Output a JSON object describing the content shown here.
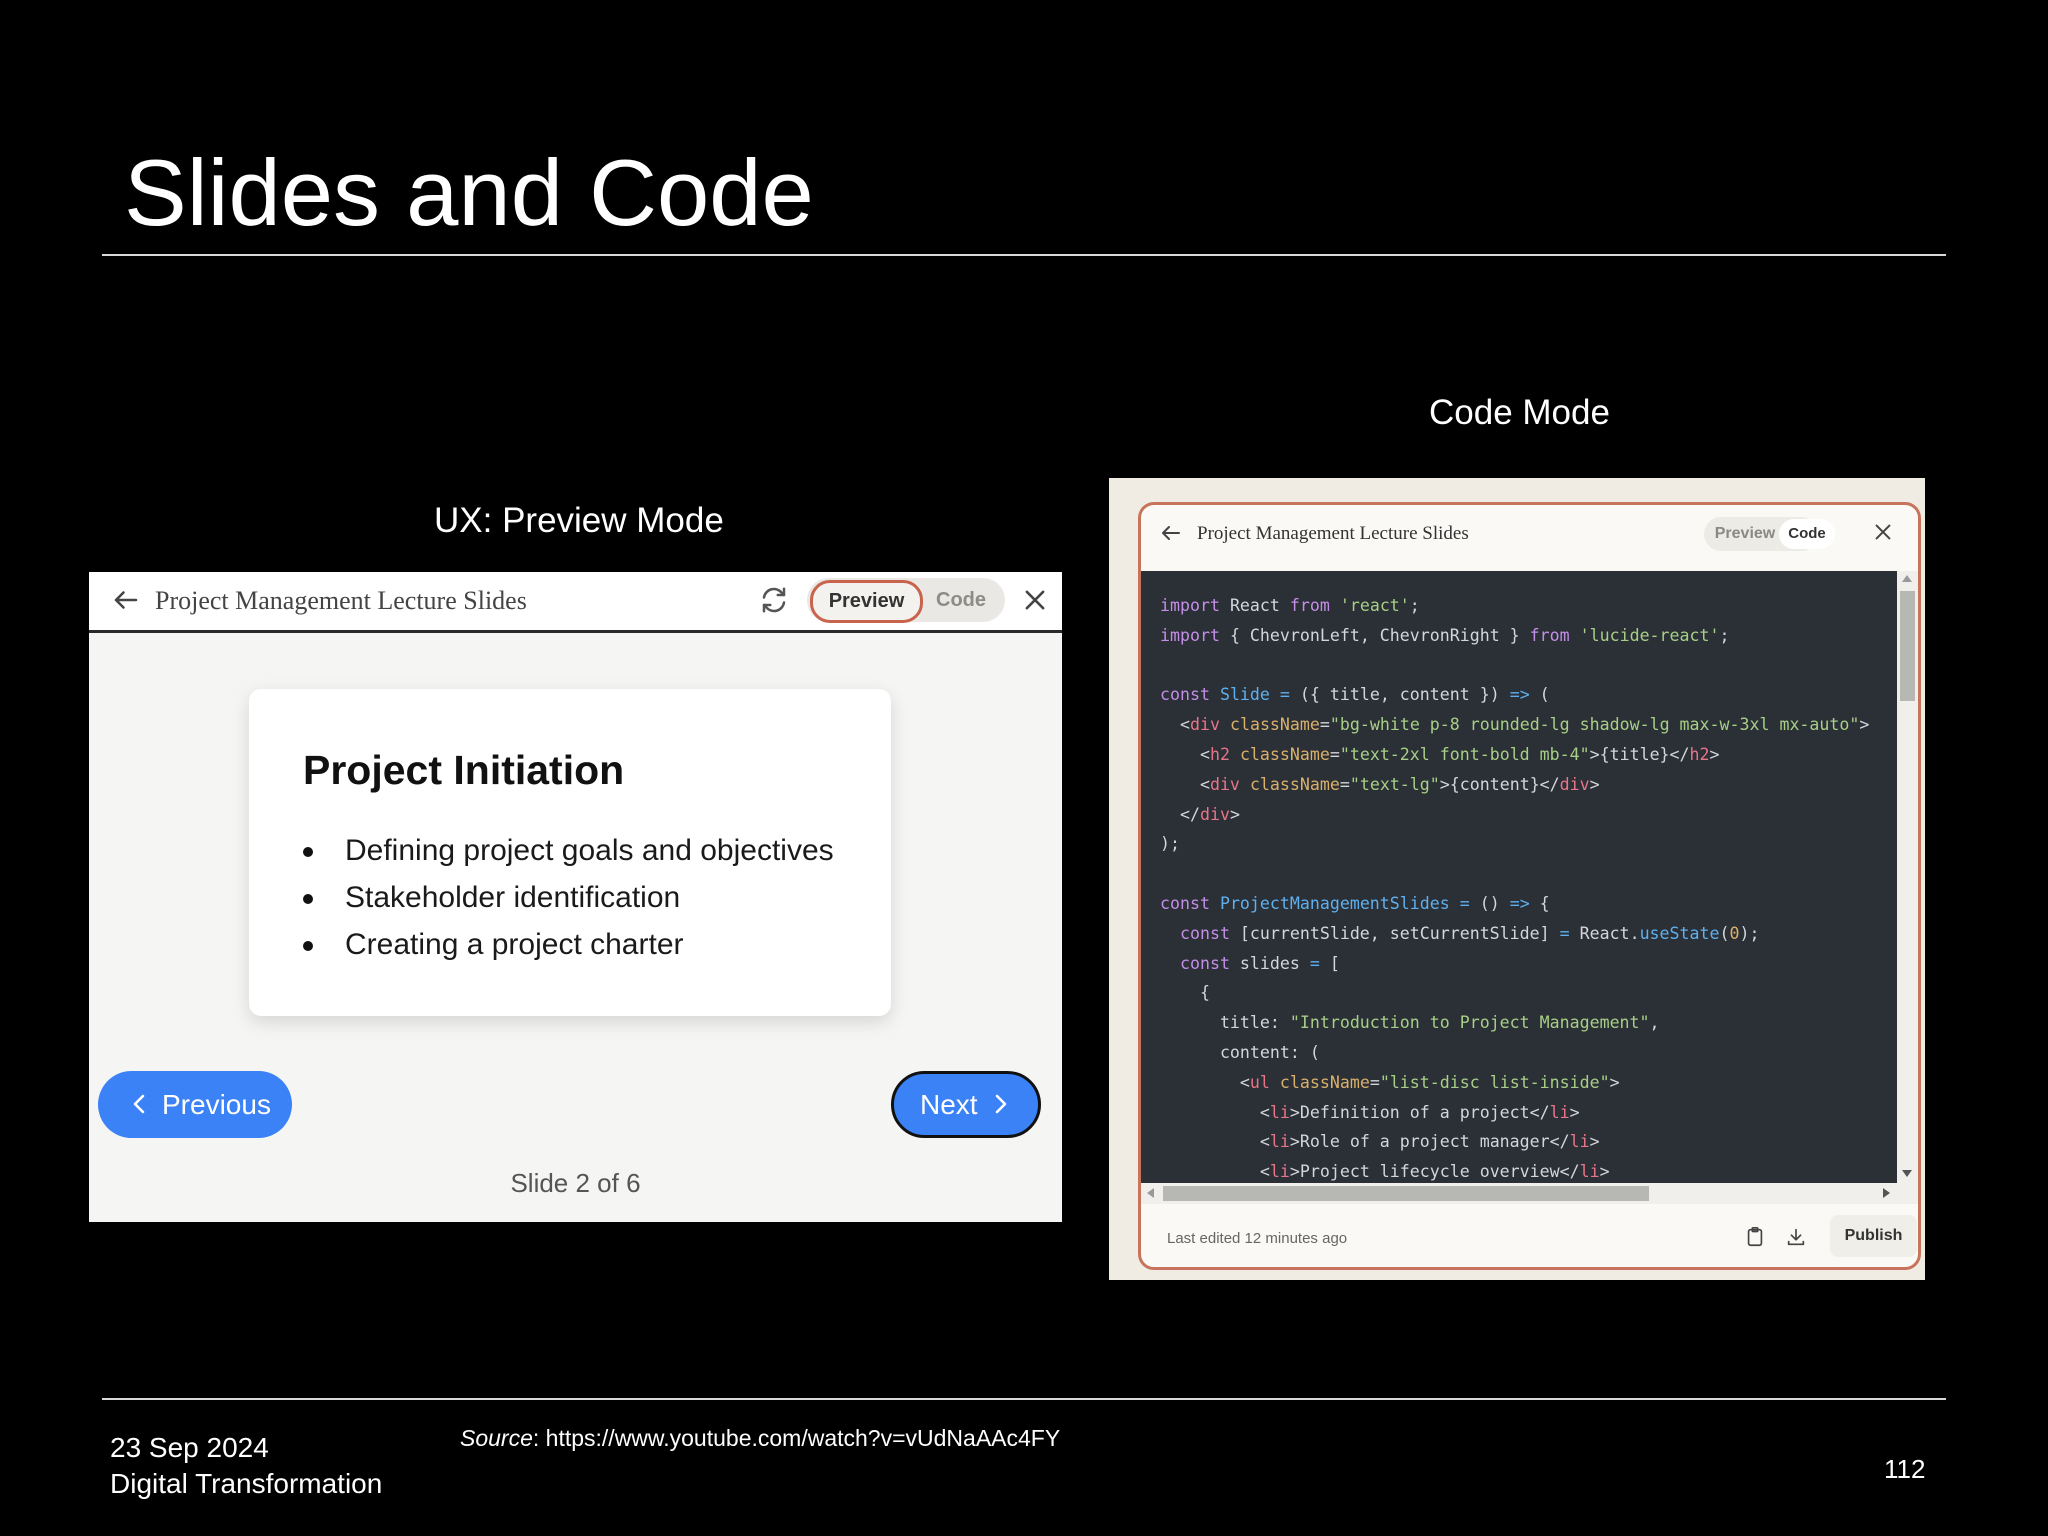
{
  "slide": {
    "title": "Slides and Code",
    "caption_preview": "UX: Preview Mode",
    "caption_code": "Code Mode",
    "footer_date": "23 Sep 2024",
    "footer_course": "Digital Transformation",
    "source_label": "Source",
    "source_url": ": https://www.youtube.com/watch?v=vUdNaAAc4FY",
    "page_number": "112"
  },
  "preview_panel": {
    "header_title": "Project Management Lecture Slides",
    "tab_preview": "Preview",
    "tab_code": "Code",
    "card_title": "Project Initiation",
    "bullets": [
      "Defining project goals and objectives",
      "Stakeholder identification",
      "Creating a project charter"
    ],
    "prev_label": "Previous",
    "next_label": "Next",
    "slide_counter": "Slide 2 of 6"
  },
  "code_panel": {
    "header_title": "Project Management Lecture Slides",
    "tab_preview": "Preview",
    "tab_code": "Code",
    "footer_text": "Last edited 12 minutes ago",
    "publish_label": "Publish",
    "code_lines": [
      [
        [
          "kw",
          "import"
        ],
        [
          "t",
          " React "
        ],
        [
          "kw",
          "from"
        ],
        [
          "t",
          " "
        ],
        [
          "str",
          "'react'"
        ],
        [
          "t",
          ";"
        ]
      ],
      [
        [
          "kw",
          "import"
        ],
        [
          "t",
          " { ChevronLeft, ChevronRight } "
        ],
        [
          "kw",
          "from"
        ],
        [
          "t",
          " "
        ],
        [
          "str",
          "'lucide-react'"
        ],
        [
          "t",
          ";"
        ]
      ],
      [],
      [
        [
          "kw",
          "const"
        ],
        [
          "t",
          " "
        ],
        [
          "fn",
          "Slide"
        ],
        [
          "t",
          " "
        ],
        [
          "op",
          "="
        ],
        [
          "t",
          " ({ title, content }) "
        ],
        [
          "op",
          "=>"
        ],
        [
          "t",
          " ("
        ]
      ],
      [
        [
          "t",
          "  <"
        ],
        [
          "tag",
          "div"
        ],
        [
          "t",
          " "
        ],
        [
          "attr",
          "className"
        ],
        [
          "t",
          "="
        ],
        [
          "str",
          "\"bg-white p-8 rounded-lg shadow-lg max-w-3xl mx-auto\""
        ],
        [
          "t",
          ">"
        ]
      ],
      [
        [
          "t",
          "    <"
        ],
        [
          "tag",
          "h2"
        ],
        [
          "t",
          " "
        ],
        [
          "attr",
          "className"
        ],
        [
          "t",
          "="
        ],
        [
          "str",
          "\"text-2xl font-bold mb-4\""
        ],
        [
          "t",
          ">{title}</"
        ],
        [
          "tag",
          "h2"
        ],
        [
          "t",
          ">"
        ]
      ],
      [
        [
          "t",
          "    <"
        ],
        [
          "tag",
          "div"
        ],
        [
          "t",
          " "
        ],
        [
          "attr",
          "className"
        ],
        [
          "t",
          "="
        ],
        [
          "str",
          "\"text-lg\""
        ],
        [
          "t",
          ">{content}</"
        ],
        [
          "tag",
          "div"
        ],
        [
          "t",
          ">"
        ]
      ],
      [
        [
          "t",
          "  </"
        ],
        [
          "tag",
          "div"
        ],
        [
          "t",
          ">"
        ]
      ],
      [
        [
          "t",
          ");"
        ]
      ],
      [],
      [
        [
          "kw",
          "const"
        ],
        [
          "t",
          " "
        ],
        [
          "fn",
          "ProjectManagementSlides"
        ],
        [
          "t",
          " "
        ],
        [
          "op",
          "="
        ],
        [
          "t",
          " () "
        ],
        [
          "op",
          "=>"
        ],
        [
          "t",
          " {"
        ]
      ],
      [
        [
          "t",
          "  "
        ],
        [
          "kw",
          "const"
        ],
        [
          "t",
          " [currentSlide, setCurrentSlide] "
        ],
        [
          "op",
          "="
        ],
        [
          "t",
          " React."
        ],
        [
          "fn",
          "useState"
        ],
        [
          "t",
          "("
        ],
        [
          "num",
          "0"
        ],
        [
          "t",
          ");"
        ]
      ],
      [
        [
          "t",
          "  "
        ],
        [
          "kw",
          "const"
        ],
        [
          "t",
          " slides "
        ],
        [
          "op",
          "="
        ],
        [
          "t",
          " ["
        ]
      ],
      [
        [
          "t",
          "    {"
        ]
      ],
      [
        [
          "t",
          "      title: "
        ],
        [
          "str",
          "\"Introduction to Project Management\""
        ],
        [
          "t",
          ","
        ]
      ],
      [
        [
          "t",
          "      content: ("
        ]
      ],
      [
        [
          "t",
          "        <"
        ],
        [
          "tag",
          "ul"
        ],
        [
          "t",
          " "
        ],
        [
          "attr",
          "className"
        ],
        [
          "t",
          "="
        ],
        [
          "str",
          "\"list-disc list-inside\""
        ],
        [
          "t",
          ">"
        ]
      ],
      [
        [
          "t",
          "          <"
        ],
        [
          "tag",
          "li"
        ],
        [
          "t",
          ">Definition of a project</"
        ],
        [
          "tag",
          "li"
        ],
        [
          "t",
          ">"
        ]
      ],
      [
        [
          "t",
          "          <"
        ],
        [
          "tag",
          "li"
        ],
        [
          "t",
          ">Role of a project manager</"
        ],
        [
          "tag",
          "li"
        ],
        [
          "t",
          ">"
        ]
      ],
      [
        [
          "t",
          "          <"
        ],
        [
          "tag",
          "li"
        ],
        [
          "t",
          ">Project lifecycle overview</"
        ],
        [
          "tag",
          "li"
        ],
        [
          "t",
          ">"
        ]
      ]
    ]
  },
  "colors": {
    "slide_bg": "#000000",
    "nav_button_blue": "#3b82f6",
    "accent_border": "#c8644b",
    "code_bg": "#2b2f36"
  },
  "icons": {
    "back": "arrow-left-icon",
    "refresh": "refresh-icon",
    "close": "close-icon",
    "chevron_left": "chevron-left-icon",
    "chevron_right": "chevron-right-icon",
    "clipboard": "clipboard-icon",
    "download": "download-icon"
  }
}
